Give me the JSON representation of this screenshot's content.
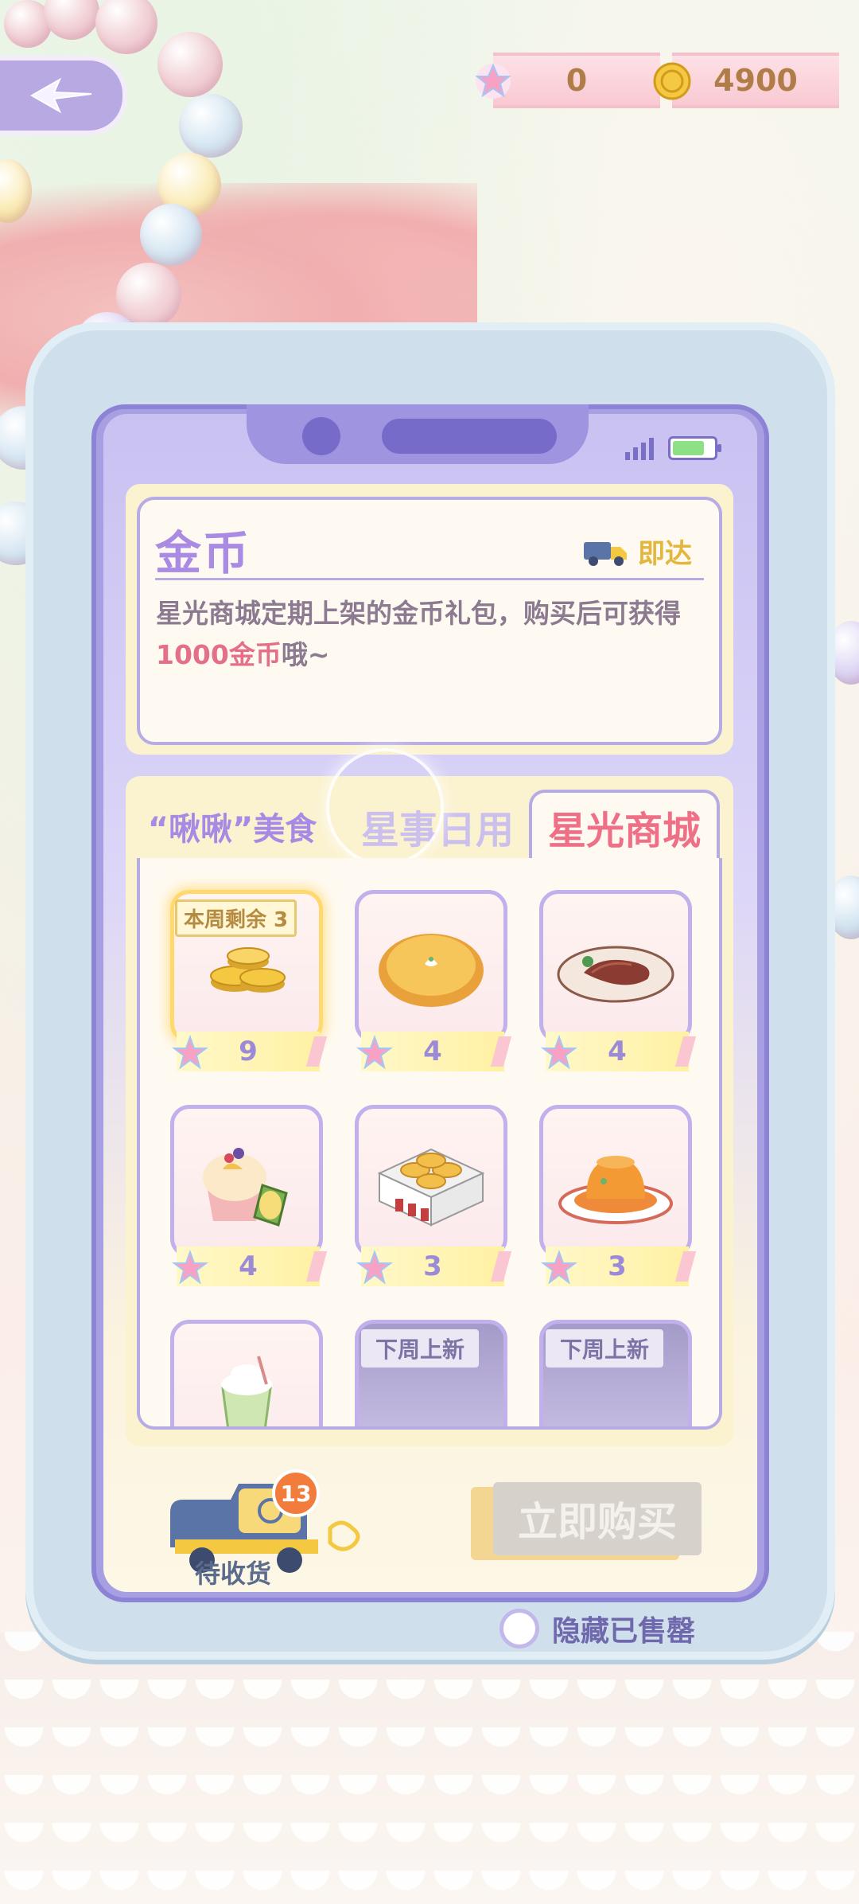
{
  "currency": {
    "stars": "0",
    "coins": "4900"
  },
  "detail": {
    "title": "金币",
    "delivery_label": "即达",
    "description_prefix": "星光商城定期上架的金币礼包，购买后可获得",
    "description_highlight": "1000金币",
    "description_suffix": "哦~"
  },
  "tabs": [
    "“啾啾”美食",
    "星事日用",
    "星光商城"
  ],
  "active_tab": 2,
  "items": [
    {
      "name": "gold-coins",
      "price": "9",
      "tag": "本周剩余 3",
      "selected": true
    },
    {
      "name": "pie",
      "price": "4"
    },
    {
      "name": "steak",
      "price": "4"
    },
    {
      "name": "durian-icecream",
      "price": "4"
    },
    {
      "name": "egg-tarts",
      "price": "3"
    },
    {
      "name": "pudding",
      "price": "3"
    },
    {
      "name": "matcha-drink",
      "price": ""
    },
    {
      "name": "locked-item-1",
      "price": "",
      "new_tag": "下周上新"
    },
    {
      "name": "locked-item-2",
      "price": "",
      "new_tag": "下周上新"
    }
  ],
  "bottom": {
    "pending_label": "待收货",
    "pending_count": "13",
    "buy_label": "立即购买",
    "hide_sold_label": "隐藏已售罄"
  },
  "colors": {
    "accent": "#a58be4",
    "highlight": "#e36f8a",
    "price": "#9b8ad8"
  }
}
